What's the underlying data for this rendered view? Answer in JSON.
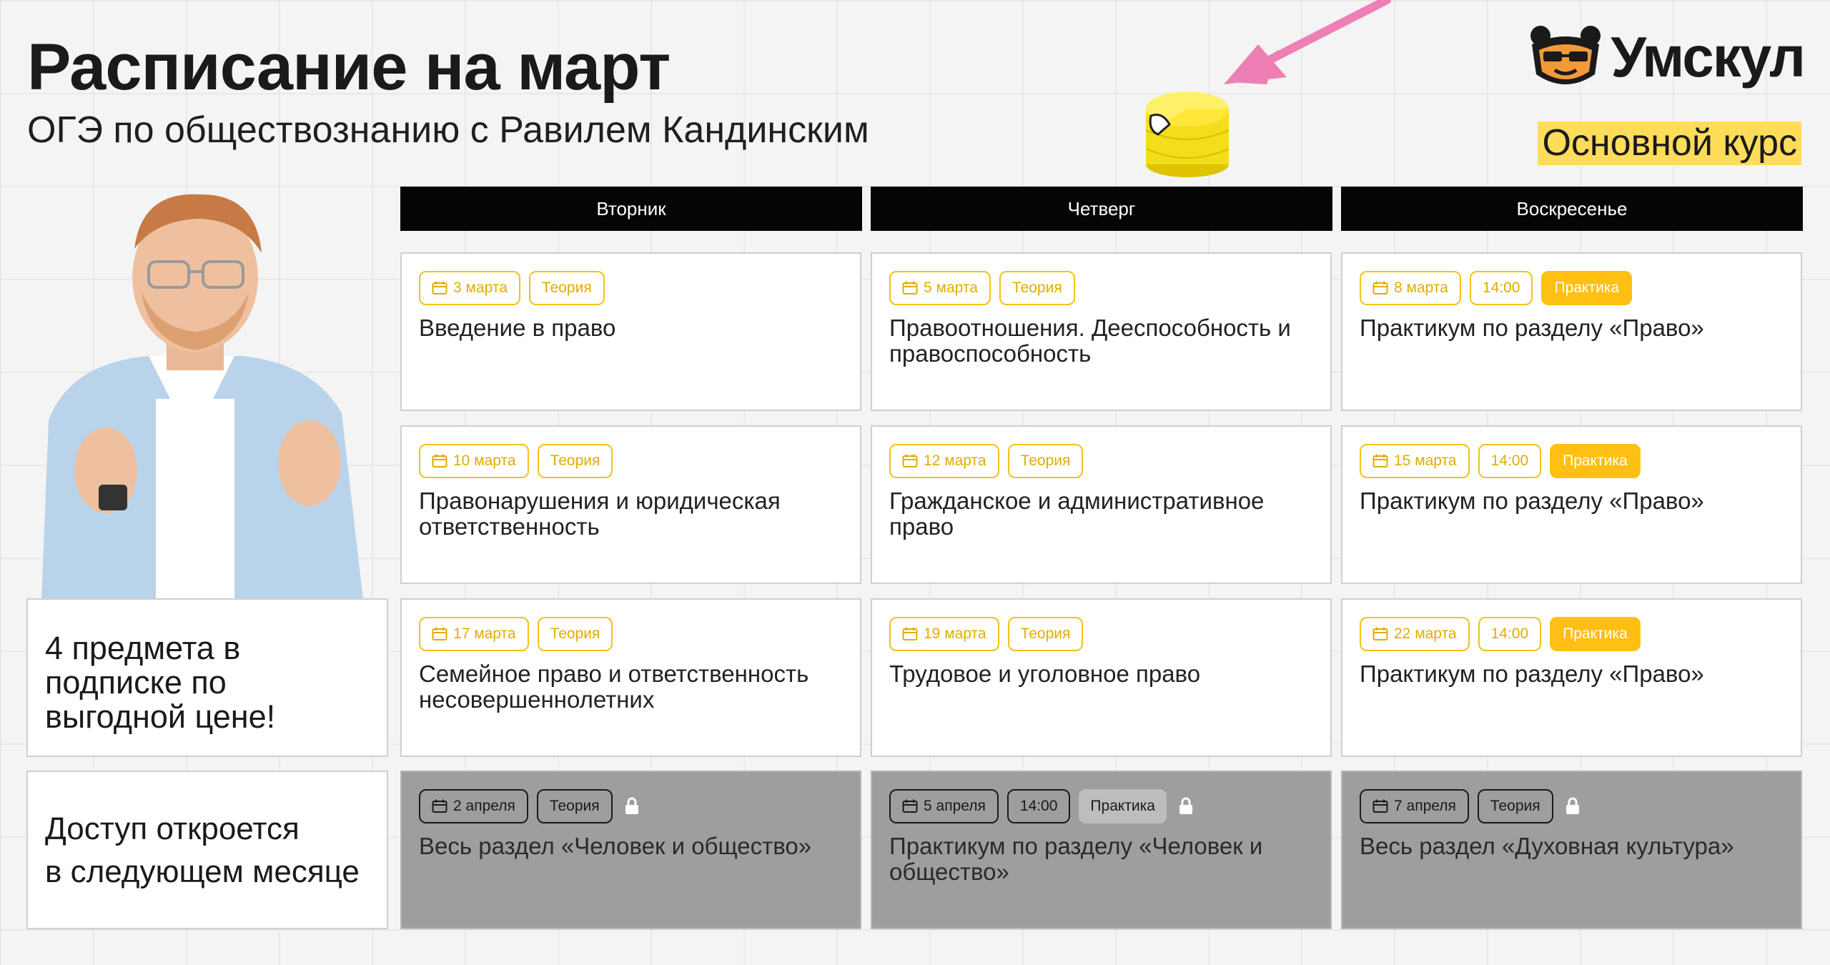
{
  "header": {
    "title": "Расписание на март",
    "subtitle": "ОГЭ по обществознанию с Равилем Кандинским",
    "logo_text": "Умскул",
    "course_badge": "Основной курс"
  },
  "colors": {
    "accent_yellow": "#ffbf13",
    "tag_border": "#f2c21a",
    "header_black": "#050505",
    "locked_gray": "#9e9e9e",
    "logo_orange": "#f29a3a"
  },
  "days": [
    "Вторник",
    "Четверг",
    "Воскресенье"
  ],
  "rows": [
    [
      {
        "date": "3 марта",
        "type": "Теория",
        "title": "Введение в право"
      },
      {
        "date": "5 марта",
        "type": "Теория",
        "title": "Правоотношения. Дееспособность и правоспособность"
      },
      {
        "date": "8 марта",
        "time": "14:00",
        "type": "Практика",
        "title": "Практикум по разделу «Право»"
      }
    ],
    [
      {
        "date": "10 марта",
        "type": "Теория",
        "title": "Правонарушения и юридическая ответственность"
      },
      {
        "date": "12 марта",
        "type": "Теория",
        "title": "Гражданское и административное право"
      },
      {
        "date": "15 марта",
        "time": "14:00",
        "type": "Практика",
        "title": "Практикум по разделу «Право»"
      }
    ],
    [
      {
        "date": "17 марта",
        "type": "Теория",
        "title": "Семейное право и ответственность несовершеннолетних"
      },
      {
        "date": "19 марта",
        "type": "Теория",
        "title": "Трудовое и уголовное право"
      },
      {
        "date": "22 марта",
        "time": "14:00",
        "type": "Практика",
        "title": "Практикум по разделу «Право»"
      }
    ],
    [
      {
        "date": "2 апреля",
        "type": "Теория",
        "title": "Весь раздел «Человек и общество»",
        "locked": true
      },
      {
        "date": "5 апреля",
        "time": "14:00",
        "type": "Практика",
        "title": "Практикум по разделу «Человек и общество»",
        "locked": true
      },
      {
        "date": "7 апреля",
        "type": "Теория",
        "title": "Весь раздел «Духовная культура»",
        "locked": true
      }
    ]
  ],
  "promo": {
    "subscription": "4 предмета в подписке по выгодной цене!",
    "access_line1": "Доступ откроется",
    "access_line2": "в следующем месяце"
  },
  "icons": {
    "calendar": "calendar-icon",
    "lock": "lock-icon",
    "logo": "bear-logo-icon",
    "arrow": "pink-arrow-icon",
    "coins": "coin-stack-icon"
  }
}
